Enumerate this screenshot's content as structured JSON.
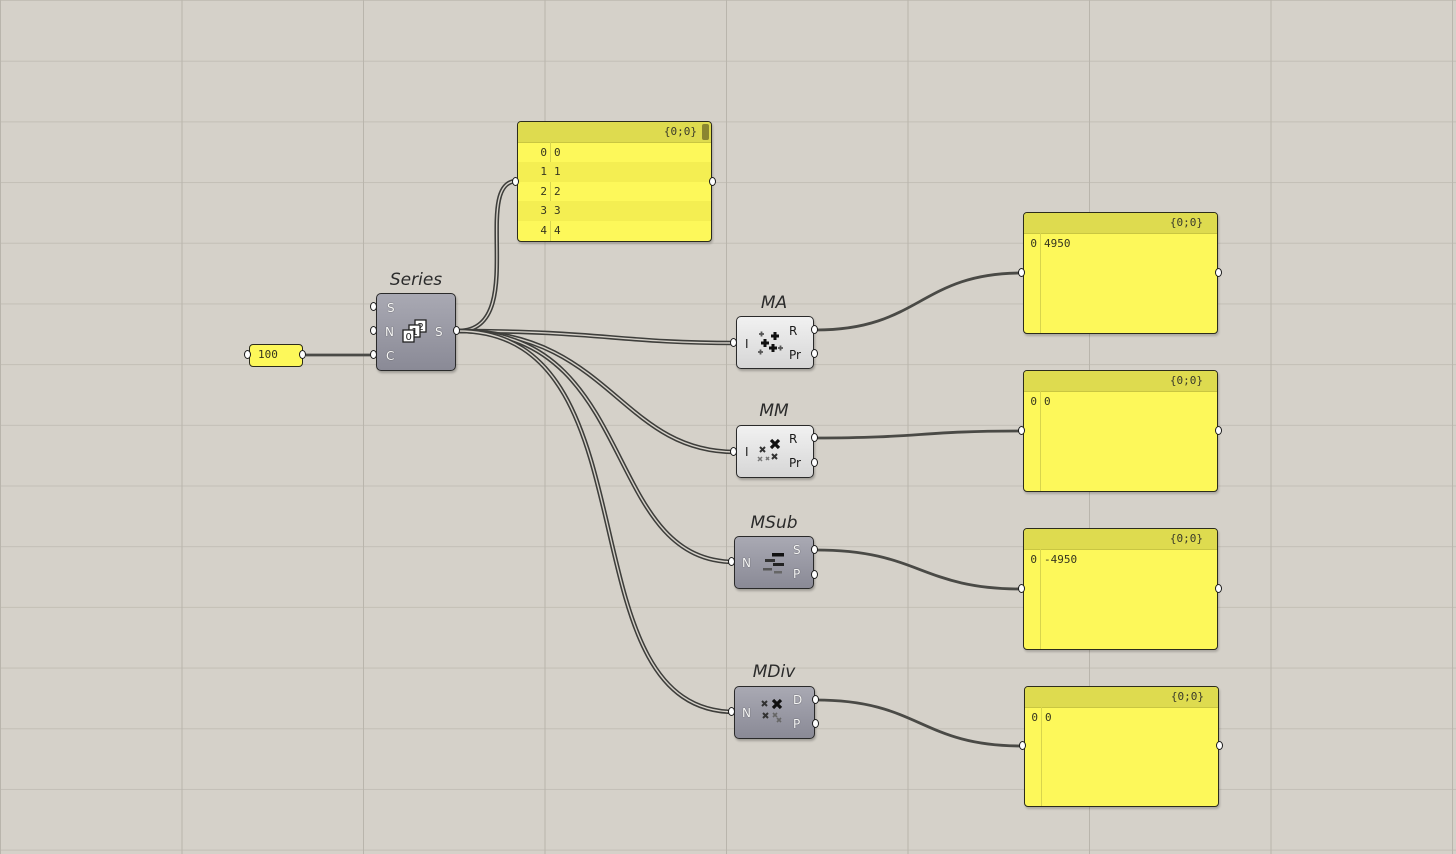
{
  "number_param": {
    "value": "100"
  },
  "series": {
    "title": "Series",
    "inputs": [
      "S",
      "N",
      "C"
    ],
    "outputs": [
      "S"
    ],
    "icon": "series-icon"
  },
  "list_panel": {
    "path": "{0;0}",
    "rows": [
      {
        "index": "0",
        "value": "0"
      },
      {
        "index": "1",
        "value": "1"
      },
      {
        "index": "2",
        "value": "2"
      },
      {
        "index": "3",
        "value": "3"
      },
      {
        "index": "4",
        "value": "4"
      }
    ]
  },
  "components": [
    {
      "title": "MA",
      "inputs": [
        "I"
      ],
      "outputs": [
        "R",
        "Pr"
      ],
      "icon": "mass-addition-icon",
      "style": "light"
    },
    {
      "title": "MM",
      "inputs": [
        "I"
      ],
      "outputs": [
        "R",
        "Pr"
      ],
      "icon": "mass-multiplication-icon",
      "style": "light"
    },
    {
      "title": "MSub",
      "inputs": [
        "N"
      ],
      "outputs": [
        "S",
        "P"
      ],
      "icon": "mass-subtraction-icon",
      "style": "dark"
    },
    {
      "title": "MDiv",
      "inputs": [
        "N"
      ],
      "outputs": [
        "D",
        "P"
      ],
      "icon": "mass-division-icon",
      "style": "dark"
    }
  ],
  "result_panels": [
    {
      "path": "{0;0}",
      "index": "0",
      "value": "4950"
    },
    {
      "path": "{0;0}",
      "index": "0",
      "value": "0"
    },
    {
      "path": "{0;0}",
      "index": "0",
      "value": "-4950"
    },
    {
      "path": "{0;0}",
      "index": "0",
      "value": "0"
    }
  ],
  "colors": {
    "canvas": "#d5d1c9",
    "panel": "#fdf85a",
    "panel_header": "#dedb4f",
    "wire": "#3e3e3b"
  }
}
